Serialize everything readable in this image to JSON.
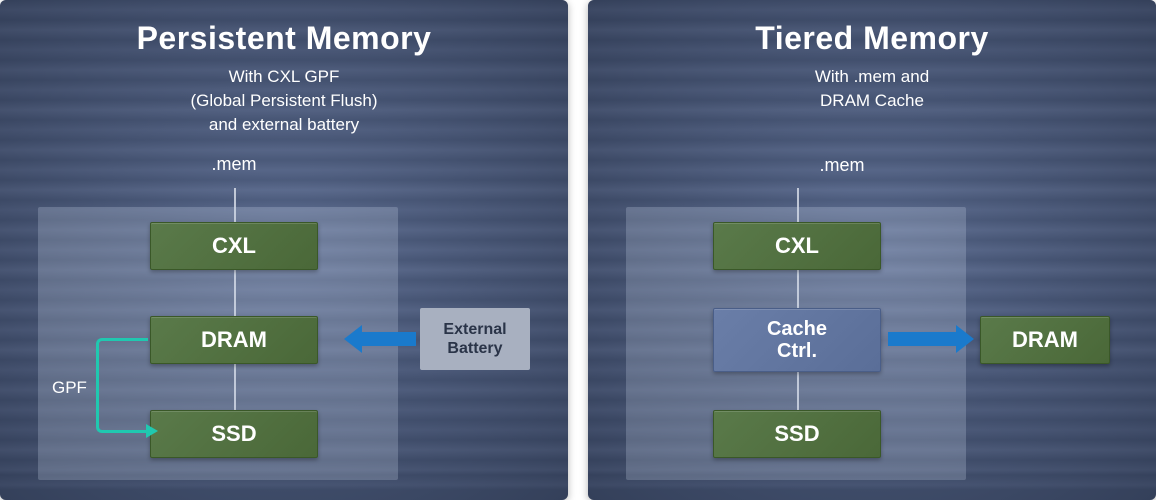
{
  "panels": [
    {
      "title": "Persistent Memory",
      "subtitle_lines": [
        "With CXL GPF",
        "(Global Persistent Flush)",
        "and external battery"
      ],
      "mem_label": ".mem",
      "blocks": {
        "cxl": "CXL",
        "dram": "DRAM",
        "ssd": "SSD"
      },
      "external_battery": "External Battery",
      "gpf_label": "GPF"
    },
    {
      "title": "Tiered Memory",
      "subtitle_lines": [
        "With .mem and",
        "DRAM Cache"
      ],
      "mem_label": ".mem",
      "blocks": {
        "cxl": "CXL",
        "cache": "Cache Ctrl.",
        "ssd": "SSD",
        "dram": "DRAM"
      }
    }
  ],
  "colors": {
    "green": "#4a6838",
    "blue_block": "#5a6e98",
    "gray": "#a8b0c0",
    "arrow_blue": "#1a7acc",
    "arrow_teal": "#20c8b0",
    "panel_bg": "#4a5878"
  }
}
